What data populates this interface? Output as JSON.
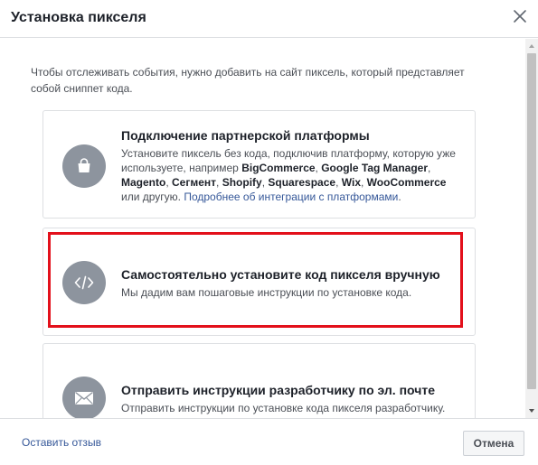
{
  "dialog": {
    "title": "Установка пикселя",
    "close_icon": "close-icon"
  },
  "intro": "Чтобы отслеживать события, нужно добавить на сайт пиксель, который представляет собой сниппет кода.",
  "options": [
    {
      "title": "Подключение партнерской платформы",
      "icon": "shopping-bag-icon",
      "desc_prefix": "Установите пиксель без кода, подключив платформу, которую уже используете, например ",
      "partners": [
        "BigCommerce",
        "Google Tag Manager",
        "Magento",
        "Сегмент",
        "Shopify",
        "Squarespace",
        "Wix",
        "WooCommerce"
      ],
      "sep": ", ",
      "desc_suffix": " или другую. ",
      "link": "Подробнее об интеграции с платформами",
      "desc_end": "."
    },
    {
      "title": "Самостоятельно установите код пикселя вручную",
      "icon": "code-icon",
      "desc": "Мы дадим вам пошаговые инструкции по установке кода."
    },
    {
      "title": "Отправить инструкции разработчику по эл. почте",
      "icon": "envelope-icon",
      "desc": "Отправить инструкции по установке кода пикселя разработчику."
    }
  ],
  "highlight_color": "#e3101b",
  "footer": {
    "feedback_link": "Оставить отзыв",
    "cancel_label": "Отмена"
  }
}
